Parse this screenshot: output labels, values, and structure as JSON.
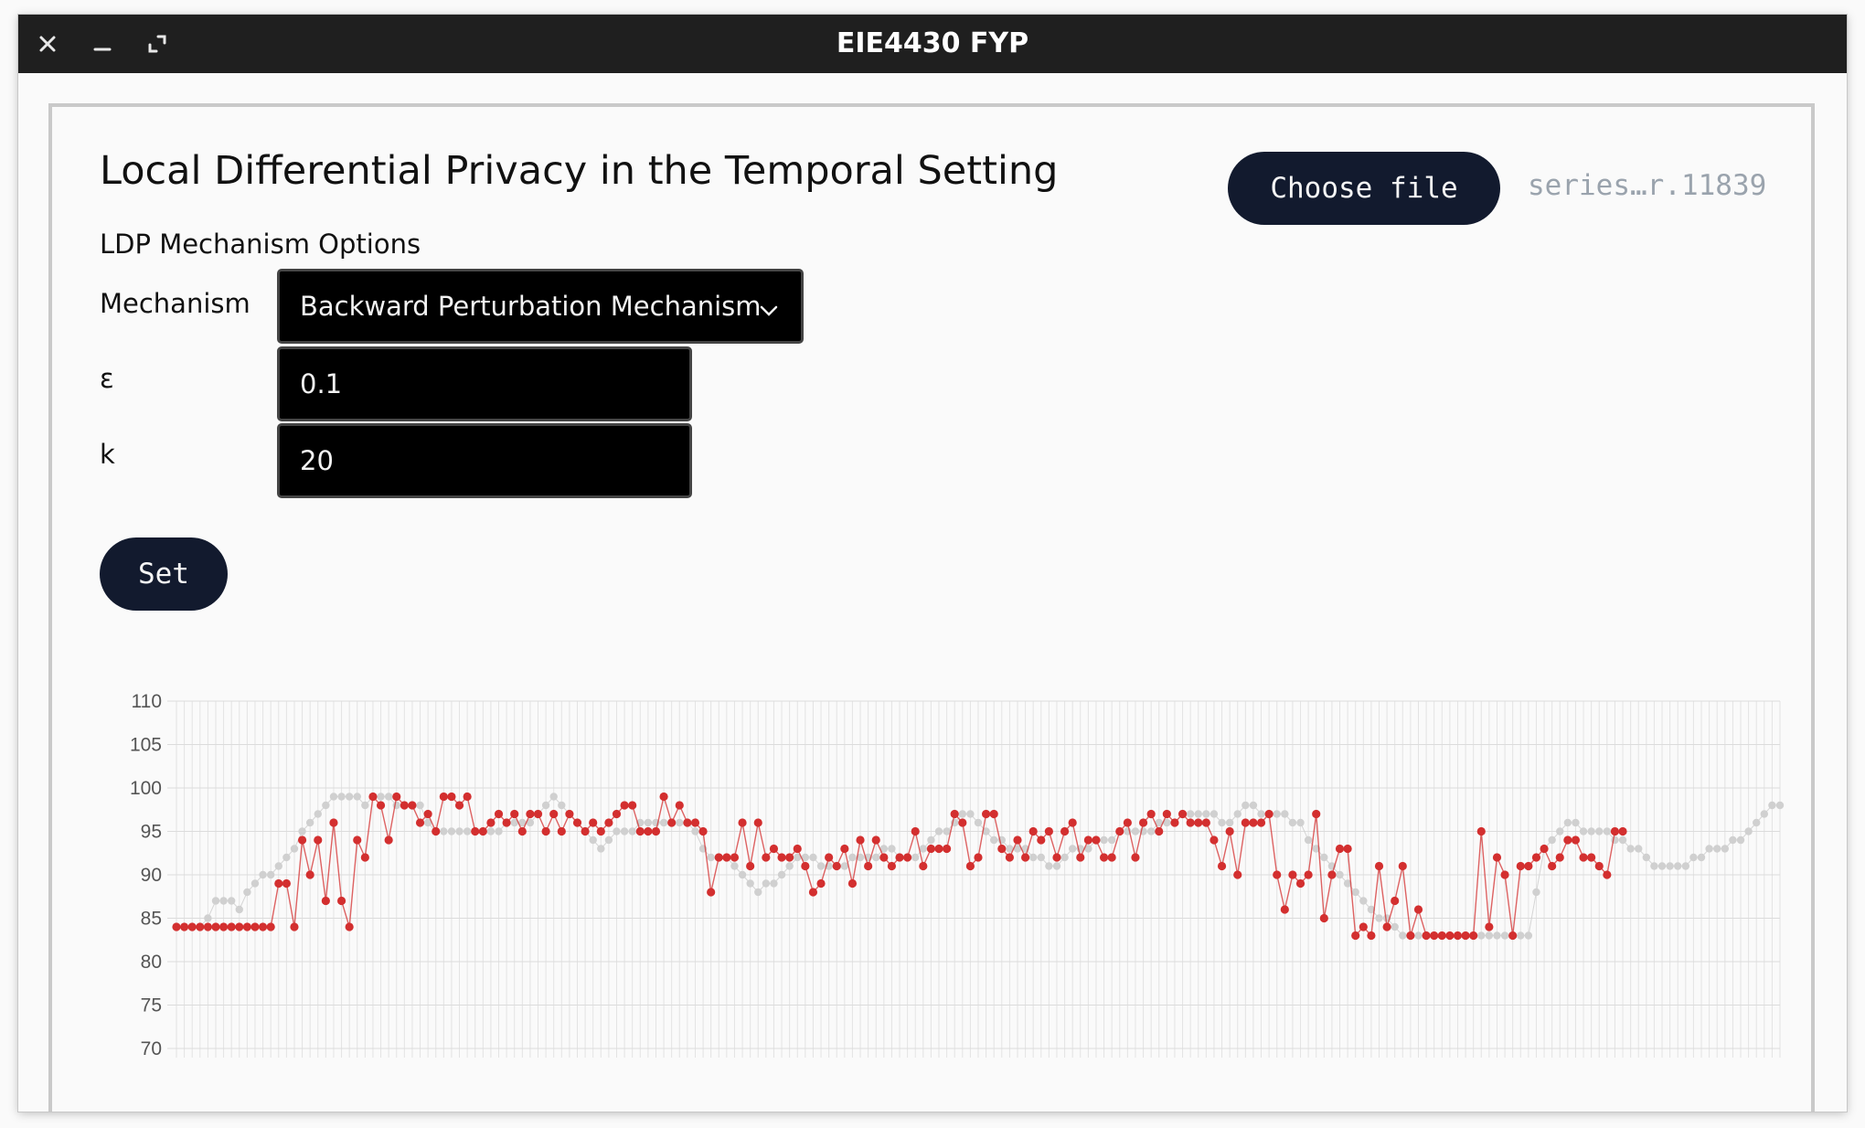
{
  "window": {
    "title": "EIE4430 FYP",
    "controls": [
      "close-icon",
      "minimize-icon",
      "maximize-icon"
    ]
  },
  "page": {
    "heading": "Local Differential Privacy in the Temporal Setting",
    "file_button": "Choose file",
    "file_name": "series…r.11839",
    "section_label": "LDP Mechanism Options"
  },
  "form": {
    "mechanism_label": "Mechanism",
    "mechanism_value": "Backward Perturbation Mechanism",
    "epsilon_label": "ε",
    "epsilon_value": "0.1",
    "k_label": "k",
    "k_value": "20",
    "set_button": "Set"
  },
  "colors": {
    "accent_button": "#121a2e",
    "perturbed_series": "#d32f2f",
    "original_series": "#d0d0d0"
  },
  "chart_data": {
    "type": "line",
    "title": "",
    "xlabel": "",
    "ylabel": "",
    "ylim": [
      70,
      110
    ],
    "yticks": [
      110,
      105,
      100,
      95,
      90,
      85,
      80,
      75,
      70
    ],
    "grid": true,
    "legend": "none",
    "series": [
      {
        "color": "#d0d0d0",
        "values": [
          84,
          84,
          84,
          84,
          85,
          87,
          87,
          87,
          86,
          88,
          89,
          90,
          90,
          91,
          92,
          93,
          95,
          96,
          97,
          98,
          99,
          99,
          99,
          99,
          98,
          99,
          99,
          99,
          98,
          98,
          98,
          98,
          96,
          95,
          95,
          95,
          95,
          95,
          95,
          95,
          95,
          95,
          96,
          96,
          96,
          96,
          97,
          98,
          99,
          98,
          97,
          96,
          95,
          94,
          93,
          94,
          95,
          95,
          95,
          96,
          96,
          96,
          96,
          96,
          96,
          96,
          95,
          93,
          92,
          92,
          92,
          91,
          90,
          89,
          88,
          89,
          89,
          90,
          91,
          92,
          92,
          92,
          91,
          91,
          91,
          91,
          92,
          92,
          92,
          92,
          93,
          93,
          92,
          92,
          92,
          93,
          94,
          95,
          95,
          96,
          97,
          97,
          96,
          95,
          94,
          94,
          93,
          93,
          93,
          92,
          92,
          91,
          91,
          92,
          93,
          93,
          93,
          94,
          94,
          94,
          95,
          95,
          95,
          95,
          95,
          96,
          96,
          96,
          97,
          97,
          97,
          97,
          97,
          96,
          96,
          97,
          98,
          98,
          97,
          97,
          97,
          97,
          96,
          96,
          94,
          93,
          92,
          91,
          90,
          89,
          88,
          87,
          86,
          85,
          85,
          84,
          83,
          83,
          83,
          83,
          83,
          83,
          83,
          83,
          83,
          83,
          83,
          83,
          83,
          83,
          83,
          83,
          83,
          88,
          93,
          94,
          95,
          96,
          96,
          95,
          95,
          95,
          95,
          94,
          94,
          93,
          93,
          92,
          91,
          91,
          91,
          91,
          91,
          92,
          92,
          93,
          93,
          93,
          94,
          94,
          95,
          96,
          97,
          98,
          98
        ]
      },
      {
        "color": "#d32f2f",
        "values": [
          84,
          84,
          84,
          84,
          84,
          84,
          84,
          84,
          84,
          84,
          84,
          84,
          84,
          89,
          89,
          84,
          94,
          90,
          94,
          87,
          96,
          87,
          84,
          94,
          92,
          99,
          98,
          94,
          99,
          98,
          98,
          96,
          97,
          95,
          99,
          99,
          98,
          99,
          95,
          95,
          96,
          97,
          96,
          97,
          95,
          97,
          97,
          95,
          97,
          95,
          97,
          96,
          95,
          96,
          95,
          96,
          97,
          98,
          98,
          95,
          95,
          95,
          99,
          96,
          98,
          96,
          96,
          95,
          88,
          92,
          92,
          92,
          96,
          91,
          96,
          92,
          93,
          92,
          92,
          93,
          91,
          88,
          89,
          92,
          91,
          93,
          89,
          94,
          91,
          94,
          92,
          91,
          92,
          92,
          95,
          91,
          93,
          93,
          93,
          97,
          96,
          91,
          92,
          97,
          97,
          93,
          92,
          94,
          92,
          95,
          94,
          95,
          92,
          95,
          96,
          92,
          94,
          94,
          92,
          92,
          95,
          96,
          92,
          96,
          97,
          95,
          97,
          96,
          97,
          96,
          96,
          96,
          94,
          91,
          95,
          90,
          96,
          96,
          96,
          97,
          90,
          86,
          90,
          89,
          90,
          97,
          85,
          90,
          93,
          93,
          83,
          84,
          83,
          91,
          84,
          87,
          91,
          83,
          86,
          83,
          83,
          83,
          83,
          83,
          83,
          83,
          95,
          84,
          92,
          90,
          83,
          91,
          91,
          92,
          93,
          91,
          92,
          94,
          94,
          92,
          92,
          91,
          90,
          95,
          95
        ]
      }
    ]
  }
}
